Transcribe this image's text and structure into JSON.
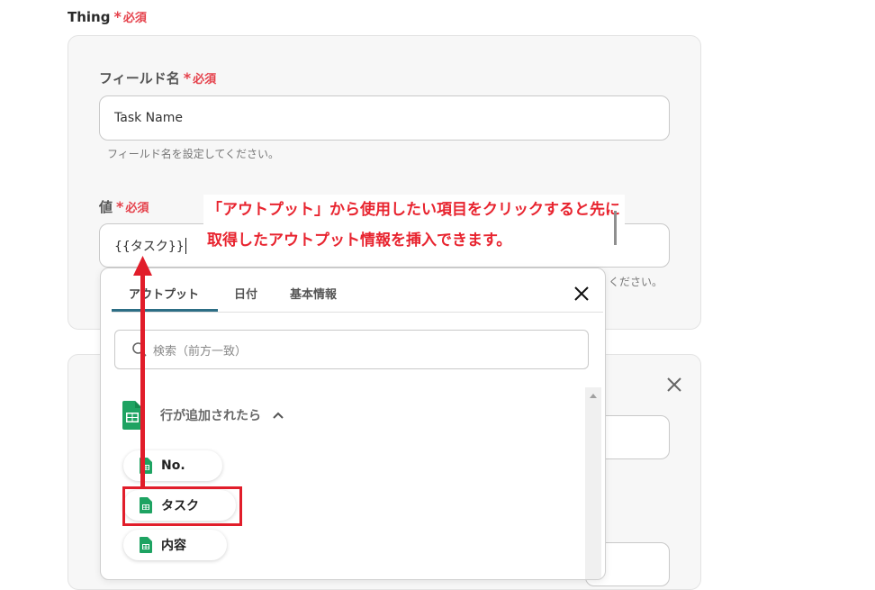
{
  "section": {
    "label": "Thing",
    "required": "必須"
  },
  "field_name": {
    "label": "フィールド名",
    "required": "必須",
    "value": "Task Name",
    "help": "フィールド名を設定してください。"
  },
  "value_field": {
    "label": "値",
    "required": "必須",
    "value": "{{タスク}}",
    "help_tail": "ください。"
  },
  "callout": {
    "line1": "「アウトプット」から使用したい項目をクリックすると先に",
    "line2": "取得したアウトプット情報を挿入できます。"
  },
  "panel": {
    "tabs": [
      "アウトプット",
      "日付",
      "基本情報"
    ],
    "active_tab": "アウトプット",
    "search_placeholder": "検索（前方一致）",
    "group_title": "行が追加されたら",
    "items": [
      "No.",
      "タスク",
      "内容"
    ]
  },
  "icons": {
    "close": "close-icon",
    "search": "search-icon",
    "sheets": "google-sheets-icon",
    "chevron": "chevron-up-icon"
  },
  "colors": {
    "required": "#e5414b",
    "annotation": "#e11d2a",
    "tab_active": "#2d6e85",
    "sheets_green": "#1ea362"
  }
}
